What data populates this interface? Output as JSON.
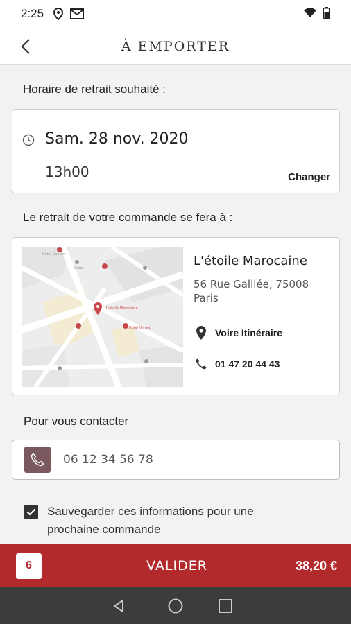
{
  "status_bar": {
    "time": "2:25"
  },
  "header": {
    "title": "À EMPORTER"
  },
  "pickup": {
    "label": "Horaire de retrait souhaité :",
    "date": "Sam. 28 nov. 2020",
    "time": "13h00",
    "change_label": "Changer"
  },
  "location": {
    "label": "Le retrait de votre commande se fera à :",
    "name": "L'étoile Marocaine",
    "address": "56 Rue Galilée, 75008 Paris",
    "itinerary_label": "Voire Itinéraire",
    "phone": "01 47 20 44 43"
  },
  "map": {
    "poi_1": "Hôtel Galilée",
    "poi_2": "L'étoile Marocaine",
    "poi_3": "Hôtel Vernet",
    "poi_4": "Shops",
    "accent_color": "#c9474a"
  },
  "contact": {
    "label": "Pour vous contacter",
    "phone_value": "06 12 34 56 78"
  },
  "save": {
    "checked": true,
    "label": "Sauvegarder ces informations pour une prochaine commande"
  },
  "order_bar": {
    "count": "6",
    "validate_label": "VALIDER",
    "total": "38,20 €",
    "color": "#b32a2c"
  }
}
